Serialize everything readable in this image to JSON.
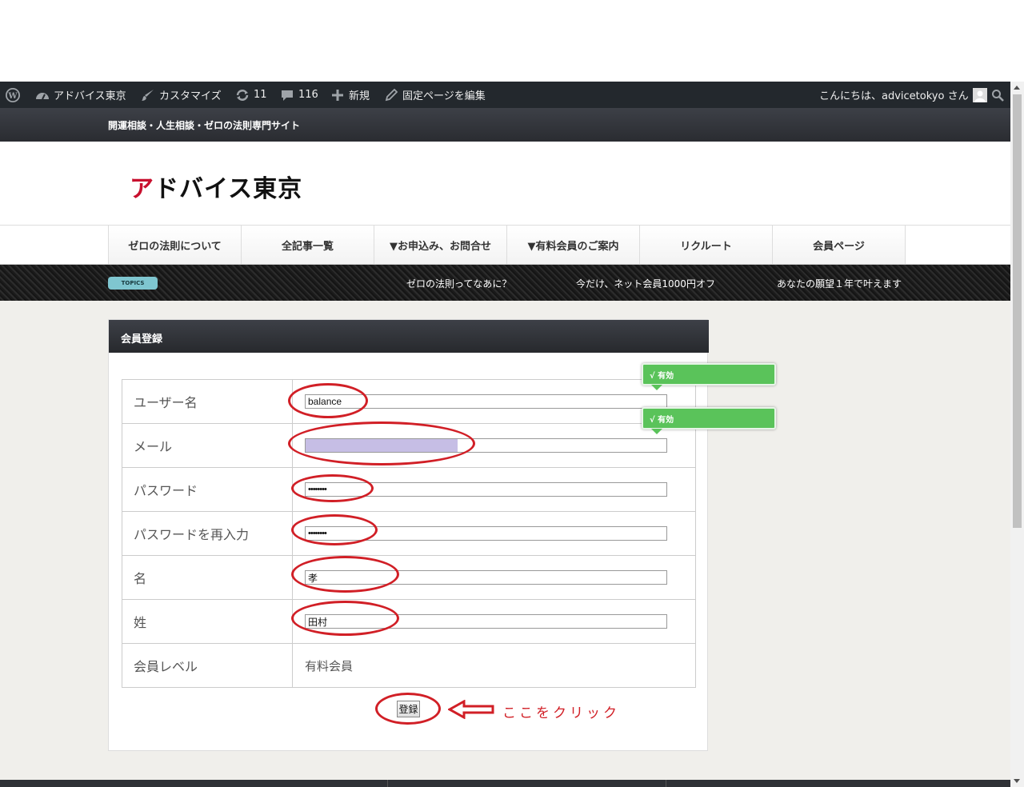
{
  "adminbar": {
    "site_name": "アドバイス東京",
    "customize": "カスタマイズ",
    "updates_count": "11",
    "comments_count": "116",
    "new_label": "新規",
    "edit_page": "固定ページを編集",
    "greeting": "こんにちは、advicetokyo さん"
  },
  "tagline": "開運相談・人生相談・ゼロの法則専門サイト",
  "logo": {
    "first": "ア",
    "rest": "ドバイス東京"
  },
  "nav": {
    "items": [
      "ゼロの法則について",
      "全記事一覧",
      "▼お申込み、お問合せ",
      "▼有料会員のご案内",
      "リクルート",
      "会員ページ"
    ]
  },
  "topics": {
    "badge": "TOPICS",
    "items": [
      "ゼロの法則ってなあに？",
      "今だけ、ネット会員1000円オフ",
      "あなたの願望１年で叶えます"
    ]
  },
  "form": {
    "title": "会員登録",
    "rows": [
      {
        "label": "ユーザー名",
        "value": "balance"
      },
      {
        "label": "メール",
        "value": ""
      },
      {
        "label": "パスワード",
        "value": "••••••••"
      },
      {
        "label": "パスワードを再入力",
        "value": "••••••••"
      },
      {
        "label": "名",
        "value": "孝"
      },
      {
        "label": "姓",
        "value": "田村"
      },
      {
        "label": "会員レベル",
        "value": "有料会員"
      }
    ],
    "submit_label": "登録",
    "tooltips": [
      "√ 有効",
      "√ 有効"
    ]
  },
  "annotation": {
    "note": "ここをクリック",
    "color": "#d11f26"
  }
}
